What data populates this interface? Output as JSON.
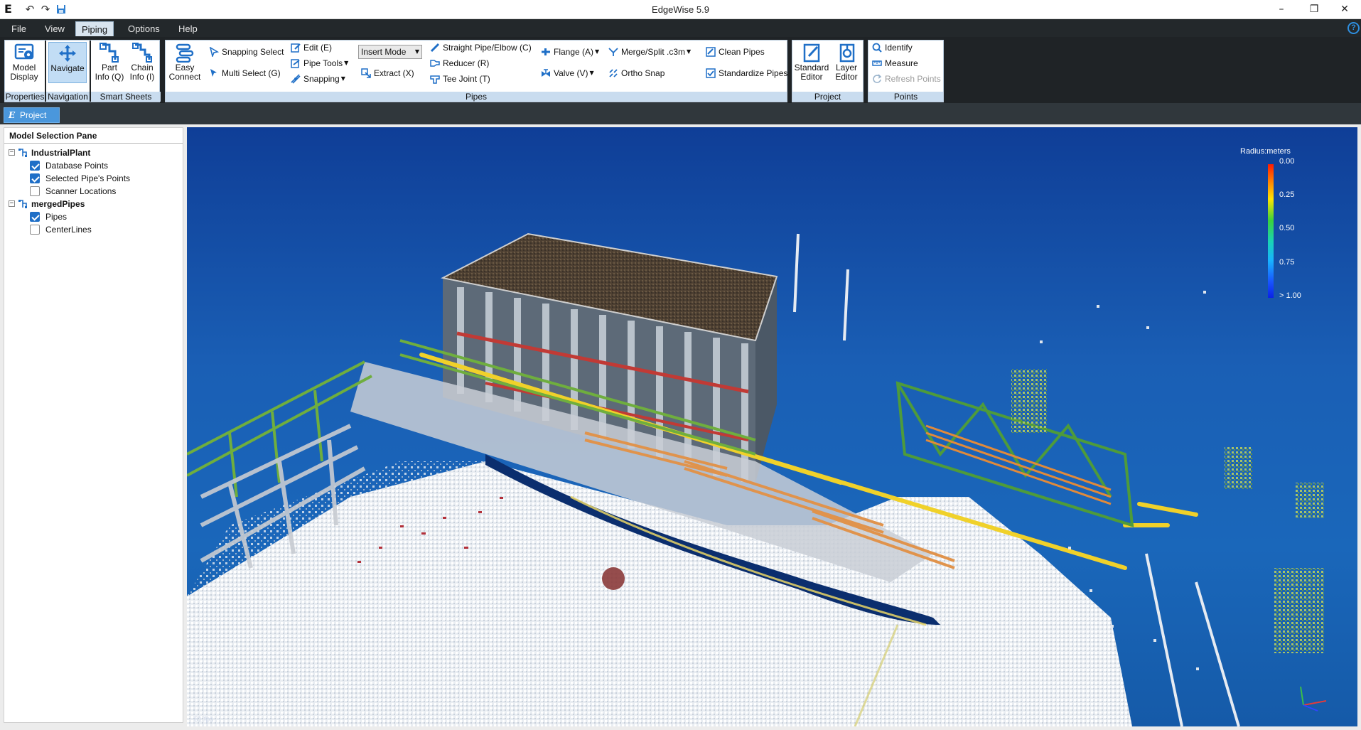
{
  "window": {
    "title": "EdgeWise 5.9",
    "app_icon": "E",
    "undo_icon": "↶",
    "redo_icon": "↷",
    "save_icon": "save-icon",
    "minimize": "–",
    "restore": "❐",
    "close": "✕"
  },
  "menu": {
    "items": [
      "File",
      "View",
      "Piping",
      "Options",
      "Help"
    ],
    "active": "Piping",
    "help_icon": "?"
  },
  "ribbon": {
    "properties": {
      "label": "Properties",
      "model_display": [
        "Model",
        "Display"
      ]
    },
    "navigation": {
      "label": "Navigation",
      "navigate": "Navigate"
    },
    "smart_sheets": {
      "label": "Smart Sheets",
      "part_info": [
        "Part",
        "Info (Q)"
      ],
      "chain_info": [
        "Chain",
        "Info (I)"
      ]
    },
    "pipes": {
      "label": "Pipes",
      "easy_connect": [
        "Easy",
        "Connect"
      ],
      "snapping_select": "Snapping Select",
      "multi_select": "Multi Select (G)",
      "edit": "Edit (E)",
      "pipe_tools": "Pipe Tools",
      "snapping": "Snapping",
      "insert_mode": "Insert Mode",
      "extract": "Extract (X)",
      "straight_pipe": "Straight Pipe/Elbow (C)",
      "reducer": "Reducer (R)",
      "tee_joint": "Tee Joint (T)",
      "flange": "Flange (A)",
      "valve": "Valve (V)",
      "merge_split": "Merge/Split .c3m",
      "ortho_snap": "Ortho Snap",
      "clean_pipes": "Clean Pipes",
      "standardize_pipes": "Standardize Pipes"
    },
    "project": {
      "label": "Project",
      "standard_editor": [
        "Standard",
        "Editor"
      ],
      "layer_editor": [
        "Layer",
        "Editor"
      ]
    },
    "points": {
      "label": "Points",
      "identify": "Identify",
      "measure": "Measure",
      "refresh_points": "Refresh Points"
    }
  },
  "doc_tab": {
    "label": "Project",
    "icon": "E"
  },
  "model_pane": {
    "title": "Model Selection Pane",
    "tree": [
      {
        "label": "IndustrialPlant",
        "level": 0,
        "expander": "−",
        "checked": null,
        "bold": true
      },
      {
        "label": "Database Points",
        "level": 1,
        "checked": true
      },
      {
        "label": "Selected Pipe's Points",
        "level": 1,
        "checked": true
      },
      {
        "label": "Scanner Locations",
        "level": 1,
        "checked": false
      },
      {
        "label": "mergedPipes",
        "level": 0,
        "expander": "−",
        "checked": null,
        "bold": true
      },
      {
        "label": "Pipes",
        "level": 1,
        "checked": true
      },
      {
        "label": "CenterLines",
        "level": 1,
        "checked": false
      }
    ]
  },
  "viewport": {
    "legend_title": "Radius:meters",
    "legend_values": [
      "0.00",
      "0.25",
      "0.50",
      "0.75",
      "> 1.00"
    ],
    "fps_label": "61 fps",
    "colors": {
      "bg_top": "#0f3e97",
      "bg_bottom": "#1a67ba",
      "accent": "#4a97dc"
    }
  }
}
